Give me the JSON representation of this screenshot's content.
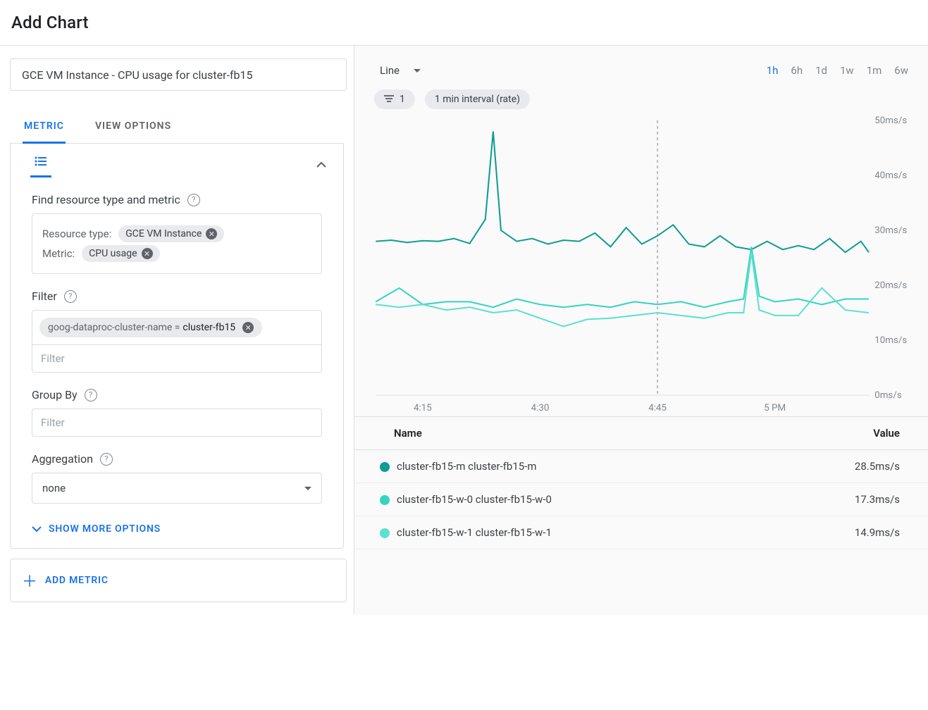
{
  "page": {
    "title": "Add Chart"
  },
  "left": {
    "title_input": "GCE VM Instance - CPU usage for cluster-fb15",
    "tabs": {
      "metric": "METRIC",
      "view_options": "VIEW OPTIONS",
      "active": "metric"
    },
    "section_find": "Find resource type and metric",
    "resource_label": "Resource type:",
    "resource_chip": "GCE VM Instance",
    "metric_label": "Metric:",
    "metric_chip": "CPU usage",
    "filter_label": "Filter",
    "filter_chip_key": "goog-dataproc-cluster-name = ",
    "filter_chip_val": "cluster-fb15",
    "filter_placeholder": "Filter",
    "groupby_label": "Group By",
    "groupby_placeholder": "Filter",
    "aggregation_label": "Aggregation",
    "aggregation_value": "none",
    "show_more": "SHOW MORE OPTIONS",
    "add_metric": "ADD METRIC"
  },
  "right": {
    "chart_type": "Line",
    "time_tabs": [
      "1h",
      "6h",
      "1d",
      "1w",
      "1m",
      "6w"
    ],
    "time_active": "1h",
    "pill_count": "1",
    "interval_pill": "1 min interval (rate)",
    "legend_header_name": "Name",
    "legend_header_value": "Value",
    "legend": [
      {
        "color": "m",
        "name": "cluster-fb15-m cluster-fb15-m",
        "value": "28.5ms/s"
      },
      {
        "color": "w0",
        "name": "cluster-fb15-w-0 cluster-fb15-w-0",
        "value": "17.3ms/s"
      },
      {
        "color": "w1",
        "name": "cluster-fb15-w-1 cluster-fb15-w-1",
        "value": "14.9ms/s"
      }
    ]
  },
  "chart_data": {
    "type": "line",
    "title": "",
    "xlabel": "",
    "ylabel": "",
    "y_unit": "ms/s",
    "ylim": [
      0,
      50
    ],
    "y_ticks": [
      0,
      10,
      20,
      30,
      40,
      50
    ],
    "x_ticks": [
      "4:15",
      "4:30",
      "4:45",
      "5 PM"
    ],
    "x_range_minutes": [
      249,
      312
    ],
    "marker_x_minute": 285,
    "series": [
      {
        "name": "cluster-fb15-m",
        "color": "#0f9d94",
        "x_minutes": [
          249,
          251,
          253,
          255,
          257,
          259,
          261,
          263,
          264,
          265,
          267,
          269,
          271,
          273,
          275,
          277,
          279,
          281,
          283,
          285,
          287,
          289,
          291,
          293,
          295,
          297,
          299,
          301,
          303,
          305,
          307,
          309,
          311,
          312
        ],
        "values": [
          28.0,
          28.2,
          27.8,
          28.1,
          28.0,
          28.5,
          27.6,
          32.0,
          48.0,
          30.0,
          28.0,
          28.5,
          27.5,
          28.2,
          28.0,
          29.5,
          27.0,
          30.5,
          27.5,
          29.0,
          31.0,
          27.5,
          27.0,
          29.0,
          27.0,
          26.5,
          28.0,
          26.5,
          27.2,
          26.5,
          28.5,
          26.0,
          28.0,
          26.0
        ]
      },
      {
        "name": "cluster-fb15-w-0",
        "color": "#34d4c1",
        "x_minutes": [
          249,
          252,
          255,
          258,
          261,
          264,
          267,
          270,
          273,
          276,
          279,
          282,
          285,
          288,
          291,
          294,
          296,
          297,
          298,
          300,
          303,
          306,
          309,
          312
        ],
        "values": [
          17.0,
          19.5,
          16.5,
          17.0,
          17.0,
          16.0,
          17.5,
          16.5,
          16.0,
          16.5,
          16.0,
          17.0,
          16.5,
          17.0,
          16.0,
          17.0,
          17.5,
          27.0,
          18.0,
          17.0,
          17.5,
          16.5,
          17.5,
          17.5
        ]
      },
      {
        "name": "cluster-fb15-w-1",
        "color": "#5ce0d0",
        "x_minutes": [
          249,
          252,
          255,
          258,
          261,
          264,
          267,
          270,
          273,
          276,
          279,
          282,
          285,
          288,
          291,
          294,
          296,
          297,
          298,
          300,
          303,
          306,
          309,
          312
        ],
        "values": [
          16.5,
          16.0,
          16.5,
          15.5,
          16.0,
          15.0,
          15.5,
          14.0,
          12.5,
          13.8,
          14.0,
          14.5,
          15.0,
          14.5,
          14.0,
          15.0,
          15.0,
          26.0,
          15.5,
          14.5,
          14.5,
          19.5,
          15.5,
          15.0
        ]
      }
    ]
  }
}
